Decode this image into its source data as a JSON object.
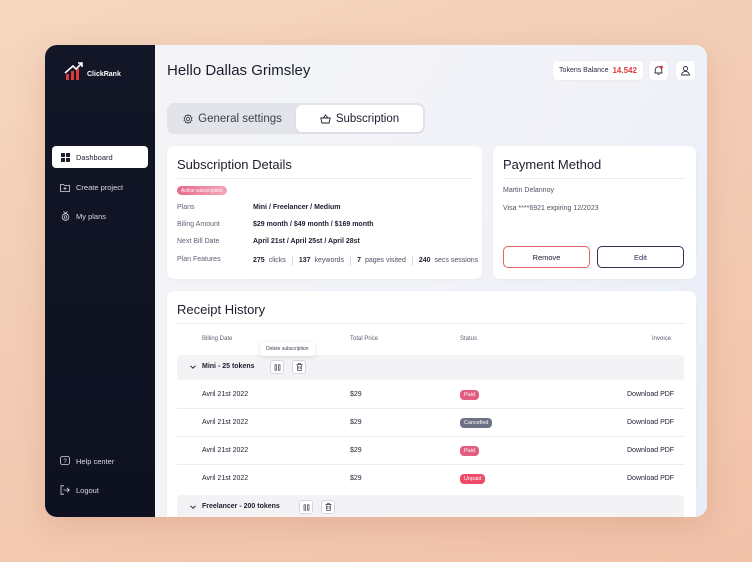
{
  "brand": {
    "name": "ClickRank"
  },
  "sidebar": {
    "items": [
      {
        "label": "Dashboard",
        "icon": "grid-icon",
        "active": true
      },
      {
        "label": "Create project",
        "icon": "folder-plus-icon",
        "active": false
      },
      {
        "label": "My plans",
        "icon": "medal-icon",
        "active": false
      }
    ],
    "bottom": [
      {
        "label": "Help center",
        "icon": "help-icon"
      },
      {
        "label": "Logout",
        "icon": "logout-icon"
      }
    ]
  },
  "header": {
    "greeting": "Hello Dallas Grimsley",
    "tokens_label": "Tokens Balance",
    "tokens_value": "14.542"
  },
  "tabs": [
    {
      "label": "General settings",
      "icon": "gear-icon",
      "active": false
    },
    {
      "label": "Subscription",
      "icon": "basket-icon",
      "active": true
    }
  ],
  "subscription": {
    "title": "Subscription Details",
    "badge": "Active subscription",
    "rows": [
      {
        "label": "Plans",
        "value": "Mini / Freelancer / Medium"
      },
      {
        "label": "Biling Amount",
        "value": "$29 month / $49 month / $169 month"
      },
      {
        "label": "Next Bill Date",
        "value": "April 21st / April 25st / April 28st"
      }
    ],
    "features_label": "Plan Features",
    "features": [
      {
        "num": "275",
        "text": "clicks"
      },
      {
        "num": "137",
        "text": "keywords"
      },
      {
        "num": "7",
        "text": "pages visited"
      },
      {
        "num": "240",
        "text": "secs sessions"
      }
    ]
  },
  "payment": {
    "title": "Payment Method",
    "name": "Martin Delannoy",
    "card": "Visa ****6921 expiring 12/2023",
    "remove_label": "Remove",
    "edit_label": "Edit"
  },
  "receipts": {
    "title": "Receipt History",
    "columns": [
      "Billing Date",
      "Total Price",
      "Status",
      "Invoice"
    ],
    "tooltip": "Delete subscription",
    "groups": [
      {
        "label": "Mini - 25 tokens"
      },
      {
        "label": "Freelancer - 200 tokens"
      }
    ],
    "rows": [
      {
        "date": "Avril 21st 2022",
        "price": "$29",
        "status": "Paid",
        "invoice": "Download PDF"
      },
      {
        "date": "Avril 21st 2022",
        "price": "$29",
        "status": "Cancelled",
        "invoice": "Download PDF"
      },
      {
        "date": "Avril 21st 2022",
        "price": "$29",
        "status": "Paid",
        "invoice": "Download PDF"
      },
      {
        "date": "Avril 21st 2022",
        "price": "$29",
        "status": "Unpaid",
        "invoice": "Download PDF"
      }
    ]
  },
  "colors": {
    "sidebar_bg": "#121626",
    "accent_red": "#e0393e",
    "paid": "#e25d81",
    "cancelled": "#6c7185",
    "unpaid": "#ef4b68"
  }
}
